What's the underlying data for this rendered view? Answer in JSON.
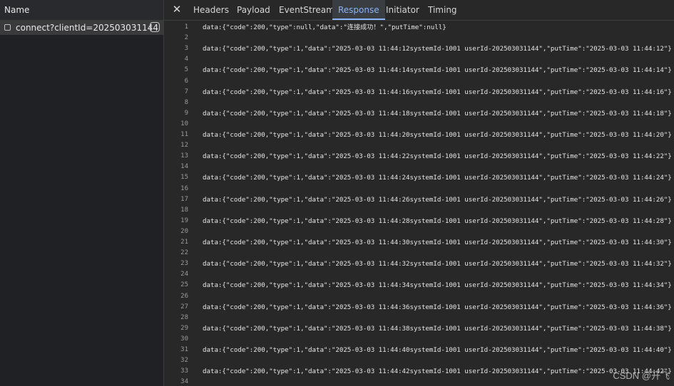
{
  "left_panel": {
    "header": "Name",
    "request": "connect?clientId=202503031144"
  },
  "tabs": [
    {
      "label": "Headers",
      "active": false
    },
    {
      "label": "Payload",
      "active": false
    },
    {
      "label": "EventStream",
      "active": false
    },
    {
      "label": "Response",
      "active": true
    },
    {
      "label": "Initiator",
      "active": false
    },
    {
      "label": "Timing",
      "active": false
    }
  ],
  "close_label": "✕",
  "response_lines": [
    {
      "num": "1",
      "text": "data:{\"code\":200,\"type\":null,\"data\":\"连接成功！\",\"putTime\":null}"
    },
    {
      "num": "2",
      "text": ""
    },
    {
      "num": "3",
      "text": "data:{\"code\":200,\"type\":1,\"data\":\"2025-03-03 11:44:12systemId-1001 userId-202503031144\",\"putTime\":\"2025-03-03 11:44:12\"}"
    },
    {
      "num": "4",
      "text": ""
    },
    {
      "num": "5",
      "text": "data:{\"code\":200,\"type\":1,\"data\":\"2025-03-03 11:44:14systemId-1001 userId-202503031144\",\"putTime\":\"2025-03-03 11:44:14\"}"
    },
    {
      "num": "6",
      "text": ""
    },
    {
      "num": "7",
      "text": "data:{\"code\":200,\"type\":1,\"data\":\"2025-03-03 11:44:16systemId-1001 userId-202503031144\",\"putTime\":\"2025-03-03 11:44:16\"}"
    },
    {
      "num": "8",
      "text": ""
    },
    {
      "num": "9",
      "text": "data:{\"code\":200,\"type\":1,\"data\":\"2025-03-03 11:44:18systemId-1001 userId-202503031144\",\"putTime\":\"2025-03-03 11:44:18\"}"
    },
    {
      "num": "10",
      "text": ""
    },
    {
      "num": "11",
      "text": "data:{\"code\":200,\"type\":1,\"data\":\"2025-03-03 11:44:20systemId-1001 userId-202503031144\",\"putTime\":\"2025-03-03 11:44:20\"}"
    },
    {
      "num": "12",
      "text": ""
    },
    {
      "num": "13",
      "text": "data:{\"code\":200,\"type\":1,\"data\":\"2025-03-03 11:44:22systemId-1001 userId-202503031144\",\"putTime\":\"2025-03-03 11:44:22\"}"
    },
    {
      "num": "14",
      "text": ""
    },
    {
      "num": "15",
      "text": "data:{\"code\":200,\"type\":1,\"data\":\"2025-03-03 11:44:24systemId-1001 userId-202503031144\",\"putTime\":\"2025-03-03 11:44:24\"}"
    },
    {
      "num": "16",
      "text": ""
    },
    {
      "num": "17",
      "text": "data:{\"code\":200,\"type\":1,\"data\":\"2025-03-03 11:44:26systemId-1001 userId-202503031144\",\"putTime\":\"2025-03-03 11:44:26\"}"
    },
    {
      "num": "18",
      "text": ""
    },
    {
      "num": "19",
      "text": "data:{\"code\":200,\"type\":1,\"data\":\"2025-03-03 11:44:28systemId-1001 userId-202503031144\",\"putTime\":\"2025-03-03 11:44:28\"}"
    },
    {
      "num": "20",
      "text": ""
    },
    {
      "num": "21",
      "text": "data:{\"code\":200,\"type\":1,\"data\":\"2025-03-03 11:44:30systemId-1001 userId-202503031144\",\"putTime\":\"2025-03-03 11:44:30\"}"
    },
    {
      "num": "22",
      "text": ""
    },
    {
      "num": "23",
      "text": "data:{\"code\":200,\"type\":1,\"data\":\"2025-03-03 11:44:32systemId-1001 userId-202503031144\",\"putTime\":\"2025-03-03 11:44:32\"}"
    },
    {
      "num": "24",
      "text": ""
    },
    {
      "num": "25",
      "text": "data:{\"code\":200,\"type\":1,\"data\":\"2025-03-03 11:44:34systemId-1001 userId-202503031144\",\"putTime\":\"2025-03-03 11:44:34\"}"
    },
    {
      "num": "26",
      "text": ""
    },
    {
      "num": "27",
      "text": "data:{\"code\":200,\"type\":1,\"data\":\"2025-03-03 11:44:36systemId-1001 userId-202503031144\",\"putTime\":\"2025-03-03 11:44:36\"}"
    },
    {
      "num": "28",
      "text": ""
    },
    {
      "num": "29",
      "text": "data:{\"code\":200,\"type\":1,\"data\":\"2025-03-03 11:44:38systemId-1001 userId-202503031144\",\"putTime\":\"2025-03-03 11:44:38\"}"
    },
    {
      "num": "30",
      "text": ""
    },
    {
      "num": "31",
      "text": "data:{\"code\":200,\"type\":1,\"data\":\"2025-03-03 11:44:40systemId-1001 userId-202503031144\",\"putTime\":\"2025-03-03 11:44:40\"}"
    },
    {
      "num": "32",
      "text": ""
    },
    {
      "num": "33",
      "text": "data:{\"code\":200,\"type\":1,\"data\":\"2025-03-03 11:44:42systemId-1001 userId-202503031144\",\"putTime\":\"2025-03-03 11:44:42\"}"
    },
    {
      "num": "34",
      "text": ""
    }
  ],
  "watermark": "CSDN @开飞"
}
